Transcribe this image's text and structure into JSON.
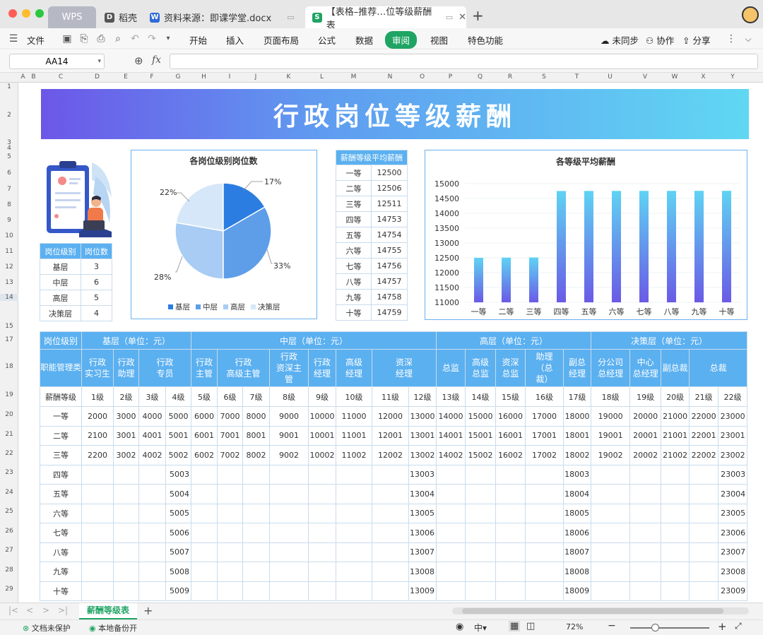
{
  "window": {
    "tabs": [
      {
        "label": "WPS"
      },
      {
        "label": "稻壳"
      },
      {
        "label": "资料来源：即课学堂.docx"
      },
      {
        "label": "【表格–推荐…位等级薪酬表"
      }
    ],
    "new_tab": "+"
  },
  "menu": {
    "file": "文件",
    "items": [
      "开始",
      "插入",
      "页面布局",
      "公式",
      "数据",
      "审阅",
      "视图",
      "特色功能"
    ],
    "active": "审阅",
    "sync": "未同步",
    "collab": "协作",
    "share": "分享"
  },
  "formula": {
    "cell_ref": "AA14",
    "fx": "fx",
    "value": ""
  },
  "columns": [
    "A",
    "B",
    "C",
    "D",
    "E",
    "F",
    "G",
    "H",
    "I",
    "J",
    "K",
    "L",
    "M",
    "N",
    "O",
    "P",
    "Q",
    "R",
    "S",
    "T",
    "U",
    "V",
    "W",
    "X",
    "Y"
  ],
  "rows": [
    "1",
    "2",
    "3",
    "4",
    "5",
    "6",
    "7",
    "8",
    "9",
    "10",
    "11",
    "12",
    "13",
    "14",
    "15",
    "17",
    "18",
    "19",
    "20",
    "21",
    "22",
    "23",
    "24",
    "25",
    "26",
    "27",
    "28",
    "29"
  ],
  "banner": {
    "title": "行政岗位等级薪酬"
  },
  "level_table": {
    "headers": [
      "岗位级别",
      "岗位数"
    ],
    "rows": [
      [
        "基层",
        "3"
      ],
      [
        "中层",
        "6"
      ],
      [
        "高层",
        "5"
      ],
      [
        "决策层",
        "4"
      ]
    ]
  },
  "pie": {
    "title": "各岗位级别岗位数",
    "labels": [
      "17%",
      "33%",
      "28%",
      "22%"
    ],
    "legend": [
      "基层",
      "中层",
      "高层",
      "决策层"
    ]
  },
  "avg_table": {
    "header": "薪酬等级平均薪酬",
    "rows": [
      [
        "一等",
        "12500"
      ],
      [
        "二等",
        "12506"
      ],
      [
        "三等",
        "12511"
      ],
      [
        "四等",
        "14753"
      ],
      [
        "五等",
        "14754"
      ],
      [
        "六等",
        "14755"
      ],
      [
        "七等",
        "14756"
      ],
      [
        "八等",
        "14757"
      ],
      [
        "九等",
        "14758"
      ],
      [
        "十等",
        "14759"
      ]
    ]
  },
  "chart_data": [
    {
      "type": "pie",
      "title": "各岗位级别岗位数",
      "categories": [
        "基层",
        "中层",
        "高层",
        "决策层"
      ],
      "values": [
        3,
        6,
        5,
        4
      ],
      "percent_labels": [
        "17%",
        "33%",
        "28%",
        "22%"
      ],
      "colors": [
        "#2b7de2",
        "#5e9ee8",
        "#a8ccf3",
        "#d6e7f9"
      ],
      "legend": "bottom"
    },
    {
      "type": "bar",
      "title": "各等级平均薪酬",
      "categories": [
        "一等",
        "二等",
        "三等",
        "四等",
        "五等",
        "六等",
        "七等",
        "八等",
        "九等",
        "十等"
      ],
      "values": [
        12500,
        12506,
        12511,
        14753,
        14754,
        14755,
        14756,
        14757,
        14758,
        14759
      ],
      "ylim": [
        11000,
        15000
      ],
      "yticks": [
        "11000",
        "11500",
        "12000",
        "12500",
        "13000",
        "13500",
        "14000",
        "14500",
        "15000"
      ],
      "grid": true
    }
  ],
  "bar": {
    "title": "各等级平均薪酬"
  },
  "main": {
    "r17": [
      "岗位级别",
      "基层（单位：元）",
      "中层（单位：元）",
      "高层（单位：元）",
      "决策层（单位：元）"
    ],
    "r18": [
      "职能管理类",
      "行政\n实习生",
      "行政\n助理",
      "行政\n专员",
      "行政\n主管",
      "行政\n高级主管",
      "行政\n资深主\n管",
      "行政\n经理",
      "高级\n经理",
      "资深\n经理",
      "总监",
      "高级\n总监",
      "资深\n总监",
      "助理\n（总\n裁）",
      "副总\n经理",
      "分公司\n总经理",
      "中心\n总经理",
      "副总裁",
      "总裁"
    ],
    "r19": [
      "薪酬等级",
      "1级",
      "2级",
      "3级",
      "4级",
      "5级",
      "6级",
      "7级",
      "8级",
      "9级",
      "10级",
      "11级",
      "12级",
      "13级",
      "14级",
      "15级",
      "16级",
      "17级",
      "18级",
      "19级",
      "20级",
      "21级",
      "22级"
    ],
    "data": [
      [
        "一等",
        "2000",
        "3000",
        "4000",
        "5000",
        "6000",
        "7000",
        "8000",
        "9000",
        "10000",
        "11000",
        "12000",
        "13000",
        "14000",
        "15000",
        "16000",
        "17000",
        "18000",
        "19000",
        "20000",
        "21000",
        "22000",
        "23000"
      ],
      [
        "二等",
        "2100",
        "3001",
        "4001",
        "5001",
        "6001",
        "7001",
        "8001",
        "9001",
        "10001",
        "11001",
        "12001",
        "13001",
        "14001",
        "15001",
        "16001",
        "17001",
        "18001",
        "19001",
        "20001",
        "21001",
        "22001",
        "23001"
      ],
      [
        "三等",
        "2200",
        "3002",
        "4002",
        "5002",
        "6002",
        "7002",
        "8002",
        "9002",
        "10002",
        "11002",
        "12002",
        "13002",
        "14002",
        "15002",
        "16002",
        "17002",
        "18002",
        "19002",
        "20002",
        "21002",
        "22002",
        "23002"
      ],
      [
        "四等",
        "",
        "",
        "",
        "5003",
        "",
        "",
        "",
        "",
        "",
        "",
        "",
        "13003",
        "",
        "",
        "",
        "",
        "18003",
        "",
        "",
        "",
        "",
        "23003"
      ],
      [
        "五等",
        "",
        "",
        "",
        "5004",
        "",
        "",
        "",
        "",
        "",
        "",
        "",
        "13004",
        "",
        "",
        "",
        "",
        "18004",
        "",
        "",
        "",
        "",
        "23004"
      ],
      [
        "六等",
        "",
        "",
        "",
        "5005",
        "",
        "",
        "",
        "",
        "",
        "",
        "",
        "13005",
        "",
        "",
        "",
        "",
        "18005",
        "",
        "",
        "",
        "",
        "23005"
      ],
      [
        "七等",
        "",
        "",
        "",
        "5006",
        "",
        "",
        "",
        "",
        "",
        "",
        "",
        "13006",
        "",
        "",
        "",
        "",
        "18006",
        "",
        "",
        "",
        "",
        "23006"
      ],
      [
        "八等",
        "",
        "",
        "",
        "5007",
        "",
        "",
        "",
        "",
        "",
        "",
        "",
        "13007",
        "",
        "",
        "",
        "",
        "18007",
        "",
        "",
        "",
        "",
        "23007"
      ],
      [
        "九等",
        "",
        "",
        "",
        "5008",
        "",
        "",
        "",
        "",
        "",
        "",
        "",
        "13008",
        "",
        "",
        "",
        "",
        "18008",
        "",
        "",
        "",
        "",
        "23008"
      ],
      [
        "十等",
        "",
        "",
        "",
        "5009",
        "",
        "",
        "",
        "",
        "",
        "",
        "",
        "13009",
        "",
        "",
        "",
        "",
        "18009",
        "",
        "",
        "",
        "",
        "23009"
      ]
    ]
  },
  "sheet_tabs": {
    "active": "薪酬等级表",
    "add": "+"
  },
  "status": {
    "protect": "文档未保护",
    "backup": "本地备份开",
    "zoom": "72%"
  },
  "colors": {
    "accent_green": "#1fa463",
    "header_blue": "#5bb0f0",
    "banner_start": "#6c57e8",
    "banner_end": "#60d7f3",
    "bar_top": "#5fd3f3",
    "bar_bottom": "#6a5ae6"
  }
}
